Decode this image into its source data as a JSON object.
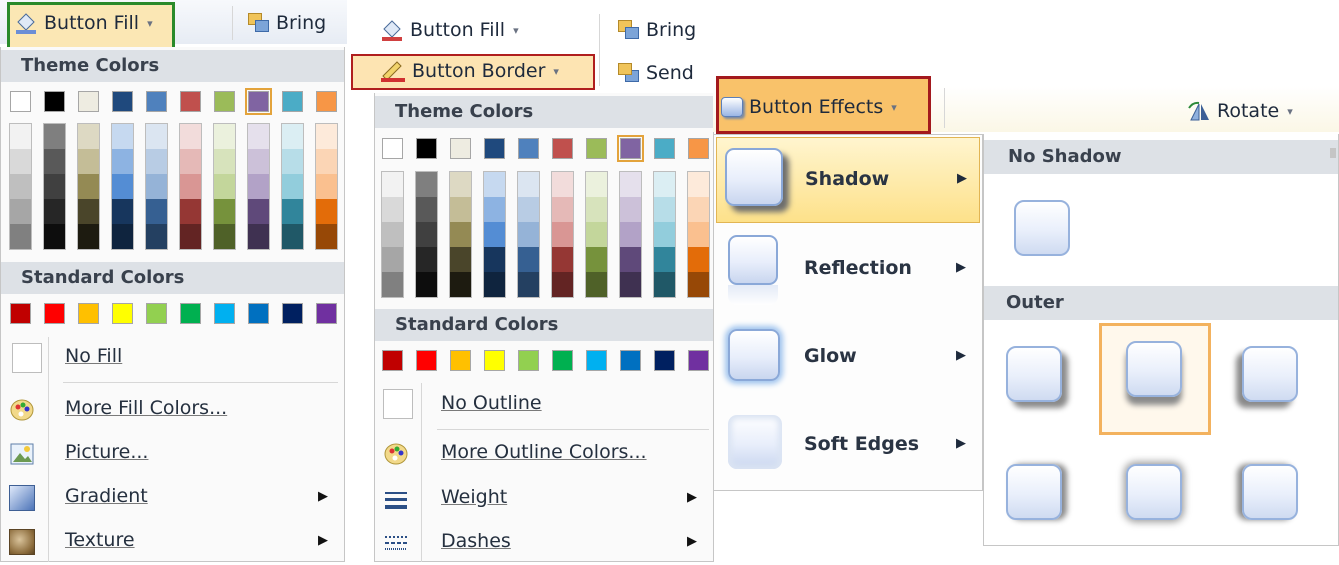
{
  "panel1": {
    "button_fill": "Button Fill",
    "bring": "Bring",
    "theme_colors": "Theme Colors",
    "standard_colors": "Standard Colors",
    "items": [
      {
        "label": "No Fill",
        "icon": "no-fill-icon",
        "submenu": false
      },
      {
        "label": "More Fill Colors...",
        "icon": "palette-icon",
        "submenu": false
      },
      {
        "label": "Picture...",
        "icon": "picture-icon",
        "submenu": false
      },
      {
        "label": "Gradient",
        "icon": "gradient-icon",
        "submenu": true
      },
      {
        "label": "Texture",
        "icon": "texture-icon",
        "submenu": true
      }
    ],
    "highlight_color": "#2a8a2a"
  },
  "panel2": {
    "button_fill": "Button Fill",
    "button_border": "Button Border",
    "bring": "Bring",
    "send": "Send",
    "theme_colors": "Theme Colors",
    "standard_colors": "Standard Colors",
    "items": [
      {
        "label": "No Outline",
        "icon": "no-outline-icon",
        "submenu": false
      },
      {
        "label": "More Outline Colors...",
        "icon": "palette-icon",
        "submenu": false
      },
      {
        "label": "Weight",
        "icon": "weight-icon",
        "submenu": true
      },
      {
        "label": "Dashes",
        "icon": "dashes-icon",
        "submenu": true
      }
    ],
    "highlight_color": "#b01e1e"
  },
  "panel3": {
    "button_effects": "Button Effects",
    "rotate": "Rotate",
    "effects": [
      {
        "label": "Shadow",
        "active": true
      },
      {
        "label": "Reflection",
        "active": false
      },
      {
        "label": "Glow",
        "active": false
      },
      {
        "label": "Soft Edges",
        "active": false
      }
    ],
    "no_shadow": "No Shadow",
    "outer": "Outer",
    "highlight_color": "#a3191d",
    "selected_color": "#f3b25e"
  },
  "theme_top_row": [
    "#ffffff",
    "#000000",
    "#eeece1",
    "#1f497d",
    "#4f81bd",
    "#c0504d",
    "#9bbb59",
    "#8064a2",
    "#4bacc6",
    "#f79646"
  ],
  "theme_columns": [
    [
      "#f2f2f2",
      "#d9d9d9",
      "#bfbfbf",
      "#a6a6a6",
      "#808080"
    ],
    [
      "#7f7f7f",
      "#595959",
      "#404040",
      "#262626",
      "#0d0d0d"
    ],
    [
      "#ddd9c3",
      "#c4bd97",
      "#948a54",
      "#4a452a",
      "#1d1b10"
    ],
    [
      "#c6d9f0",
      "#8db3e2",
      "#548dd4",
      "#17365d",
      "#0f243e"
    ],
    [
      "#dbe5f1",
      "#b8cce4",
      "#95b3d7",
      "#366092",
      "#244061"
    ],
    [
      "#f2dcdb",
      "#e5b9b7",
      "#d99694",
      "#953734",
      "#632423"
    ],
    [
      "#ebf1dd",
      "#d7e3bc",
      "#c3d69b",
      "#76923c",
      "#4f6128"
    ],
    [
      "#e5e0ec",
      "#ccc1d9",
      "#b2a2c7",
      "#5f497a",
      "#3f3151"
    ],
    [
      "#dbeef3",
      "#b7dde8",
      "#92cddc",
      "#31859b",
      "#205867"
    ],
    [
      "#fdeada",
      "#fbd5b5",
      "#fac08f",
      "#e36c09",
      "#974806"
    ]
  ],
  "standard_colors": [
    "#c00000",
    "#ff0000",
    "#ffc000",
    "#ffff00",
    "#92d050",
    "#00b050",
    "#00b0f0",
    "#0070c0",
    "#002060",
    "#7030a0"
  ]
}
